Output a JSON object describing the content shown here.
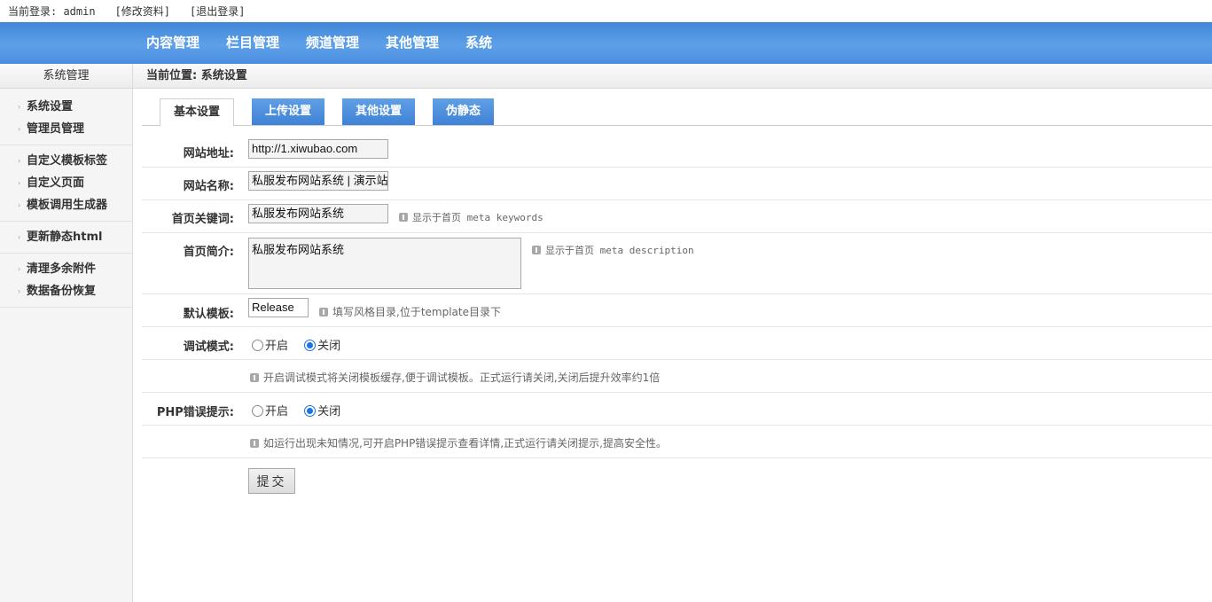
{
  "topbar": {
    "login_text": "当前登录: admin",
    "edit_profile": "[修改资料]",
    "logout": "[退出登录]"
  },
  "nav": {
    "items": [
      "内容管理",
      "栏目管理",
      "频道管理",
      "其他管理",
      "系统"
    ]
  },
  "sidebar": {
    "title": "系统管理",
    "groups": [
      [
        "系统设置",
        "管理员管理"
      ],
      [
        "自定义模板标签",
        "自定义页面",
        "模板调用生成器"
      ],
      [
        "更新静态html"
      ],
      [
        "清理多余附件",
        "数据备份恢复"
      ]
    ]
  },
  "breadcrumb": "当前位置: 系统设置",
  "tabs": [
    "基本设置",
    "上传设置",
    "其他设置",
    "伪静态"
  ],
  "form": {
    "site_url_label": "网站地址:",
    "site_url_value": "http://1.xiwubao.com",
    "site_name_label": "网站名称:",
    "site_name_value": "私服发布网站系统 | 演示站",
    "keywords_label": "首页关键词:",
    "keywords_value": "私服发布网站系统",
    "keywords_hint": "显示于首页 meta keywords",
    "desc_label": "首页简介:",
    "desc_value": "私服发布网站系统",
    "desc_hint": "显示于首页 meta description",
    "template_label": "默认模板:",
    "template_value": "Release",
    "template_hint": "填写风格目录,位于template目录下",
    "debug_label": "调试模式:",
    "debug_on": "开启",
    "debug_off": "关闭",
    "debug_selected": "关闭",
    "debug_hint": "开启调试模式将关闭模板缓存,便于调试模板。正式运行请关闭,关闭后提升效率约1倍",
    "php_error_label": "PHP错误提示:",
    "php_on": "开启",
    "php_off": "关闭",
    "php_selected": "关闭",
    "php_hint": "如运行出现未知情况,可开启PHP错误提示查看详情,正式运行请关闭提示,提高安全性。",
    "submit_label": "提交"
  },
  "colors": {
    "nav_blue": "#4a8ee0",
    "tab_blue": "#3f82d5"
  }
}
